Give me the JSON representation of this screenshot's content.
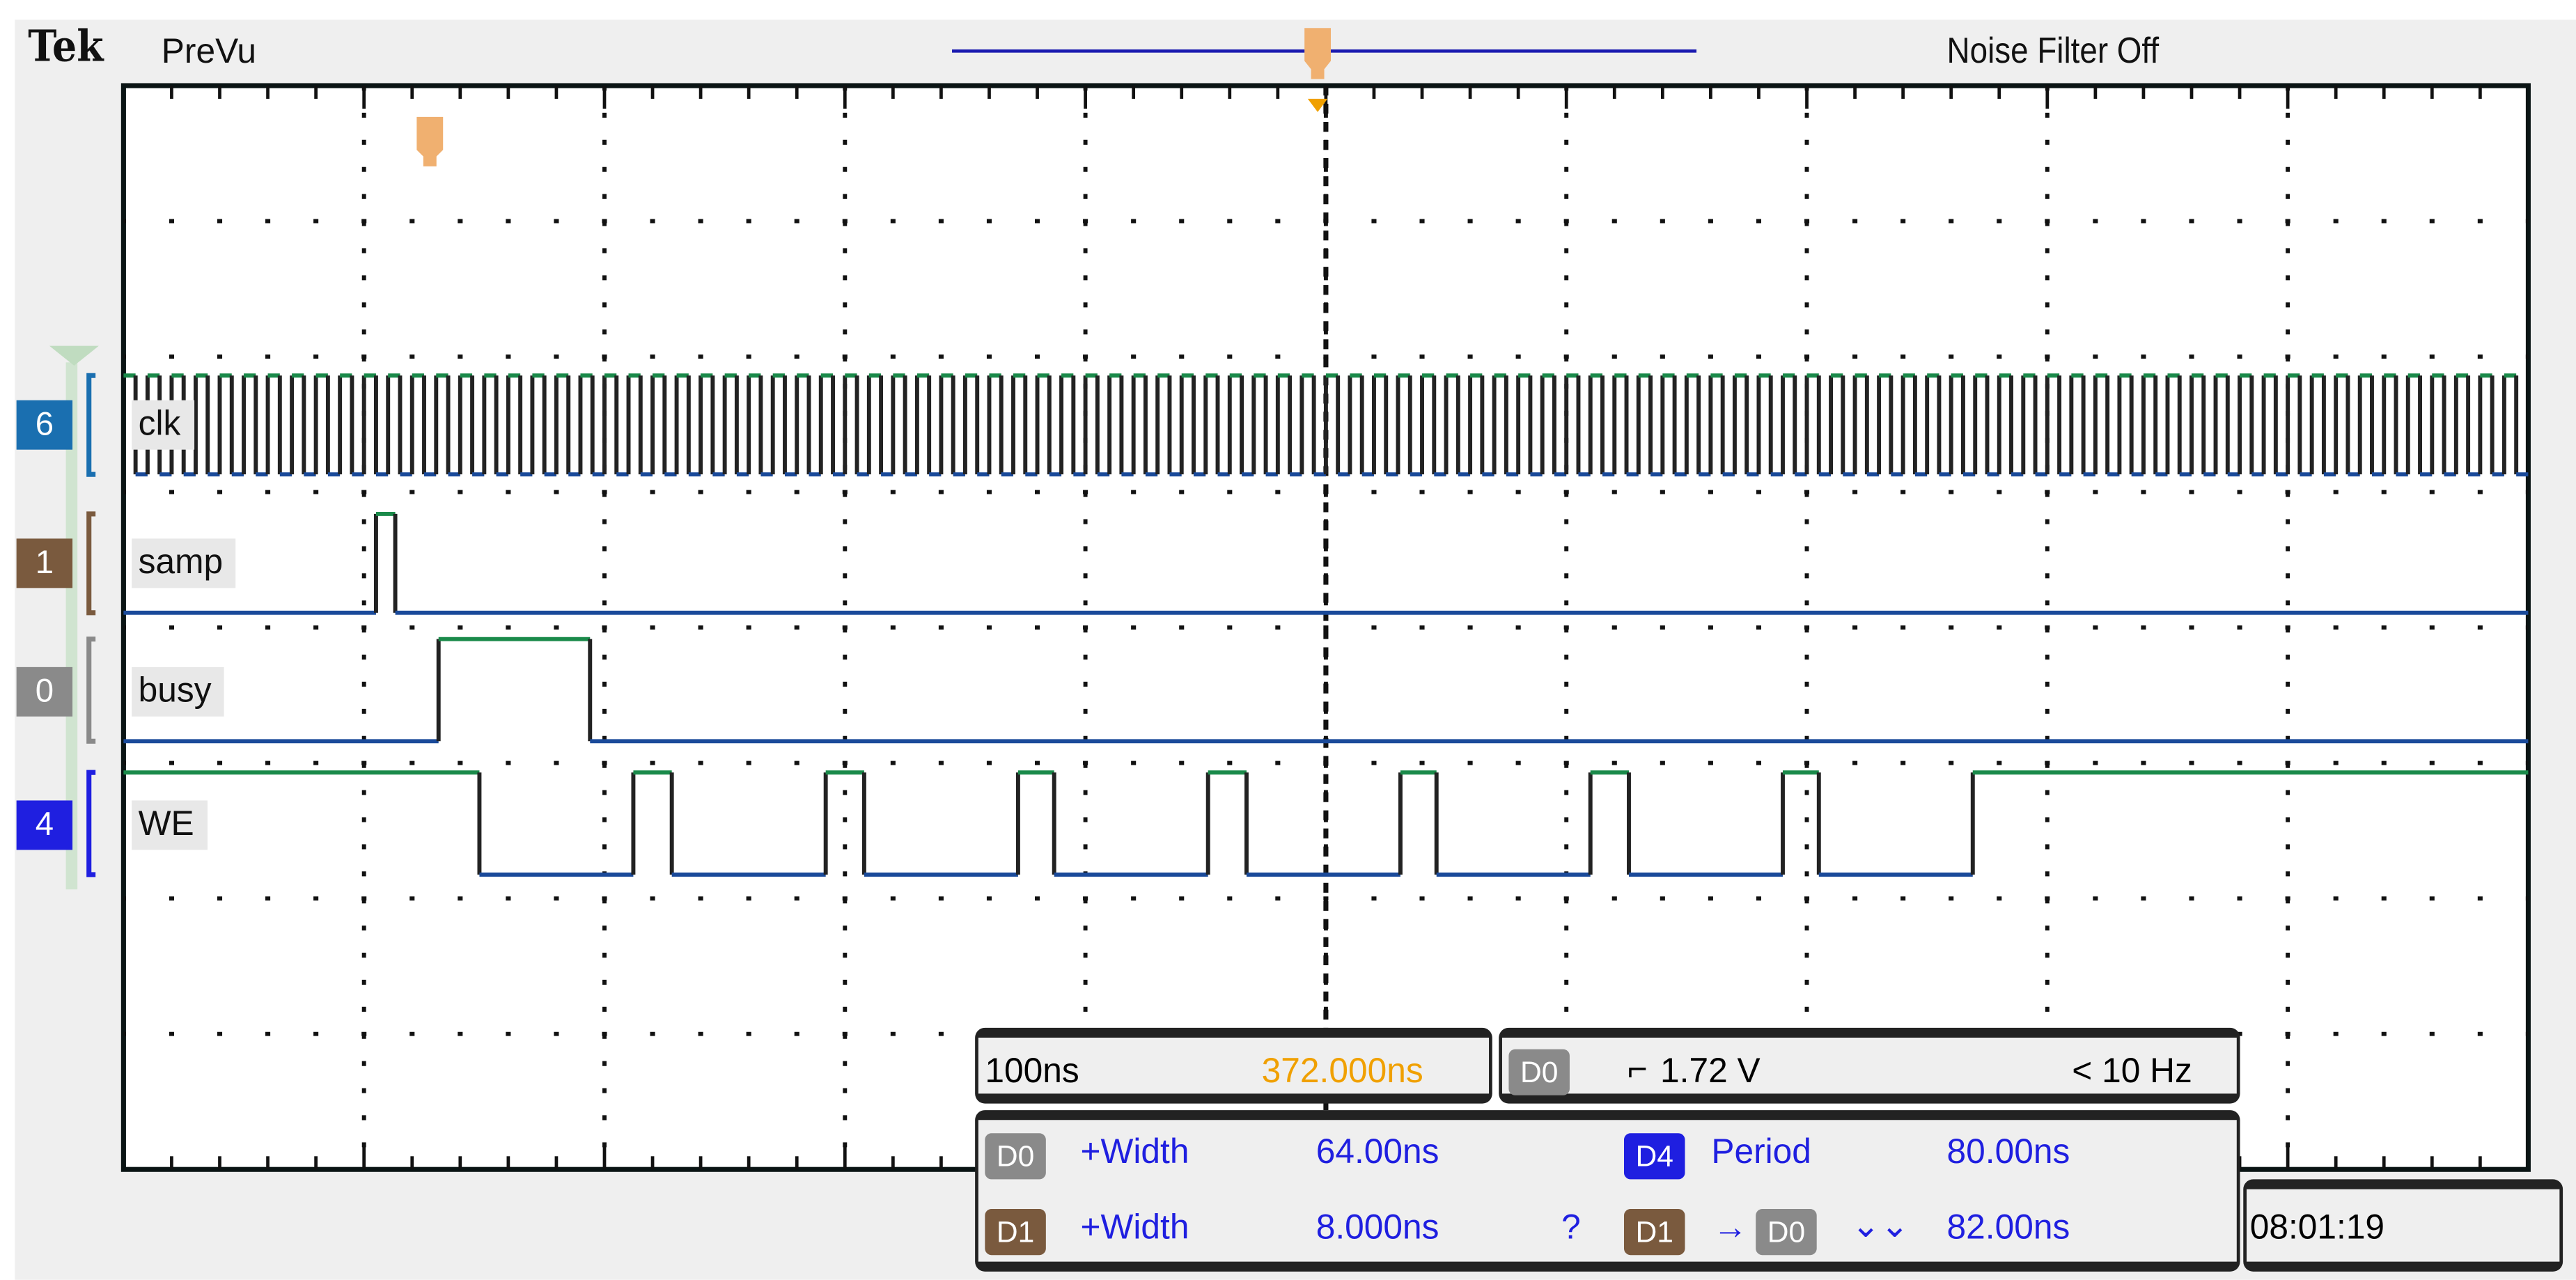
{
  "header": {
    "brand": "Tek",
    "mode": "PreVu",
    "noise_filter": "Noise Filter Off"
  },
  "colors": {
    "high": "#1a8a4a",
    "low": "#1a4a9a",
    "edge": "#222222",
    "trigger": "#f0a030",
    "grid": "#111111"
  },
  "timebase": {
    "ns_per_div": 100,
    "divisions": 10
  },
  "channels": [
    {
      "id": "6",
      "label": "clk",
      "badge_color": "#1a6fb0",
      "type": "clock",
      "period_ns": 10,
      "start_high": true
    },
    {
      "id": "1",
      "label": "samp",
      "badge_color": "#7a5a3e",
      "start_high": false,
      "transitions_ns": [
        105,
        113
      ]
    },
    {
      "id": "0",
      "label": "busy",
      "badge_color": "#8a8a8a",
      "start_high": false,
      "transitions_ns": [
        131,
        194
      ]
    },
    {
      "id": "4",
      "label": "WE",
      "badge_color": "#1f1fe0",
      "start_high": true,
      "transitions_ns": [
        148,
        212,
        228,
        292,
        308,
        372,
        387,
        451,
        467,
        531,
        546,
        610,
        626,
        690,
        705,
        769
      ]
    }
  ],
  "status": {
    "scale": "100ns",
    "position": "372.000ns",
    "trigger_source": "D0",
    "trigger_level": "1.72 V",
    "frequency": "< 10 Hz"
  },
  "measurements": [
    {
      "source": "D0",
      "source_color": "#8a8a8a",
      "type": "+Width",
      "value": "64.00ns"
    },
    {
      "source": "D4",
      "source_color": "#1f1fe0",
      "type": "Period",
      "value": "80.00ns"
    },
    {
      "source": "D1",
      "source_color": "#7a5a3e",
      "type": "+Width",
      "value": "8.000ns",
      "flag": "?"
    },
    {
      "source": "D1",
      "source_color": "#7a5a3e",
      "target": "D0",
      "target_color": "#8a8a8a",
      "arrow": "→",
      "edges": "⌄⌄",
      "value": "82.00ns"
    }
  ],
  "clock": "08:01:19"
}
